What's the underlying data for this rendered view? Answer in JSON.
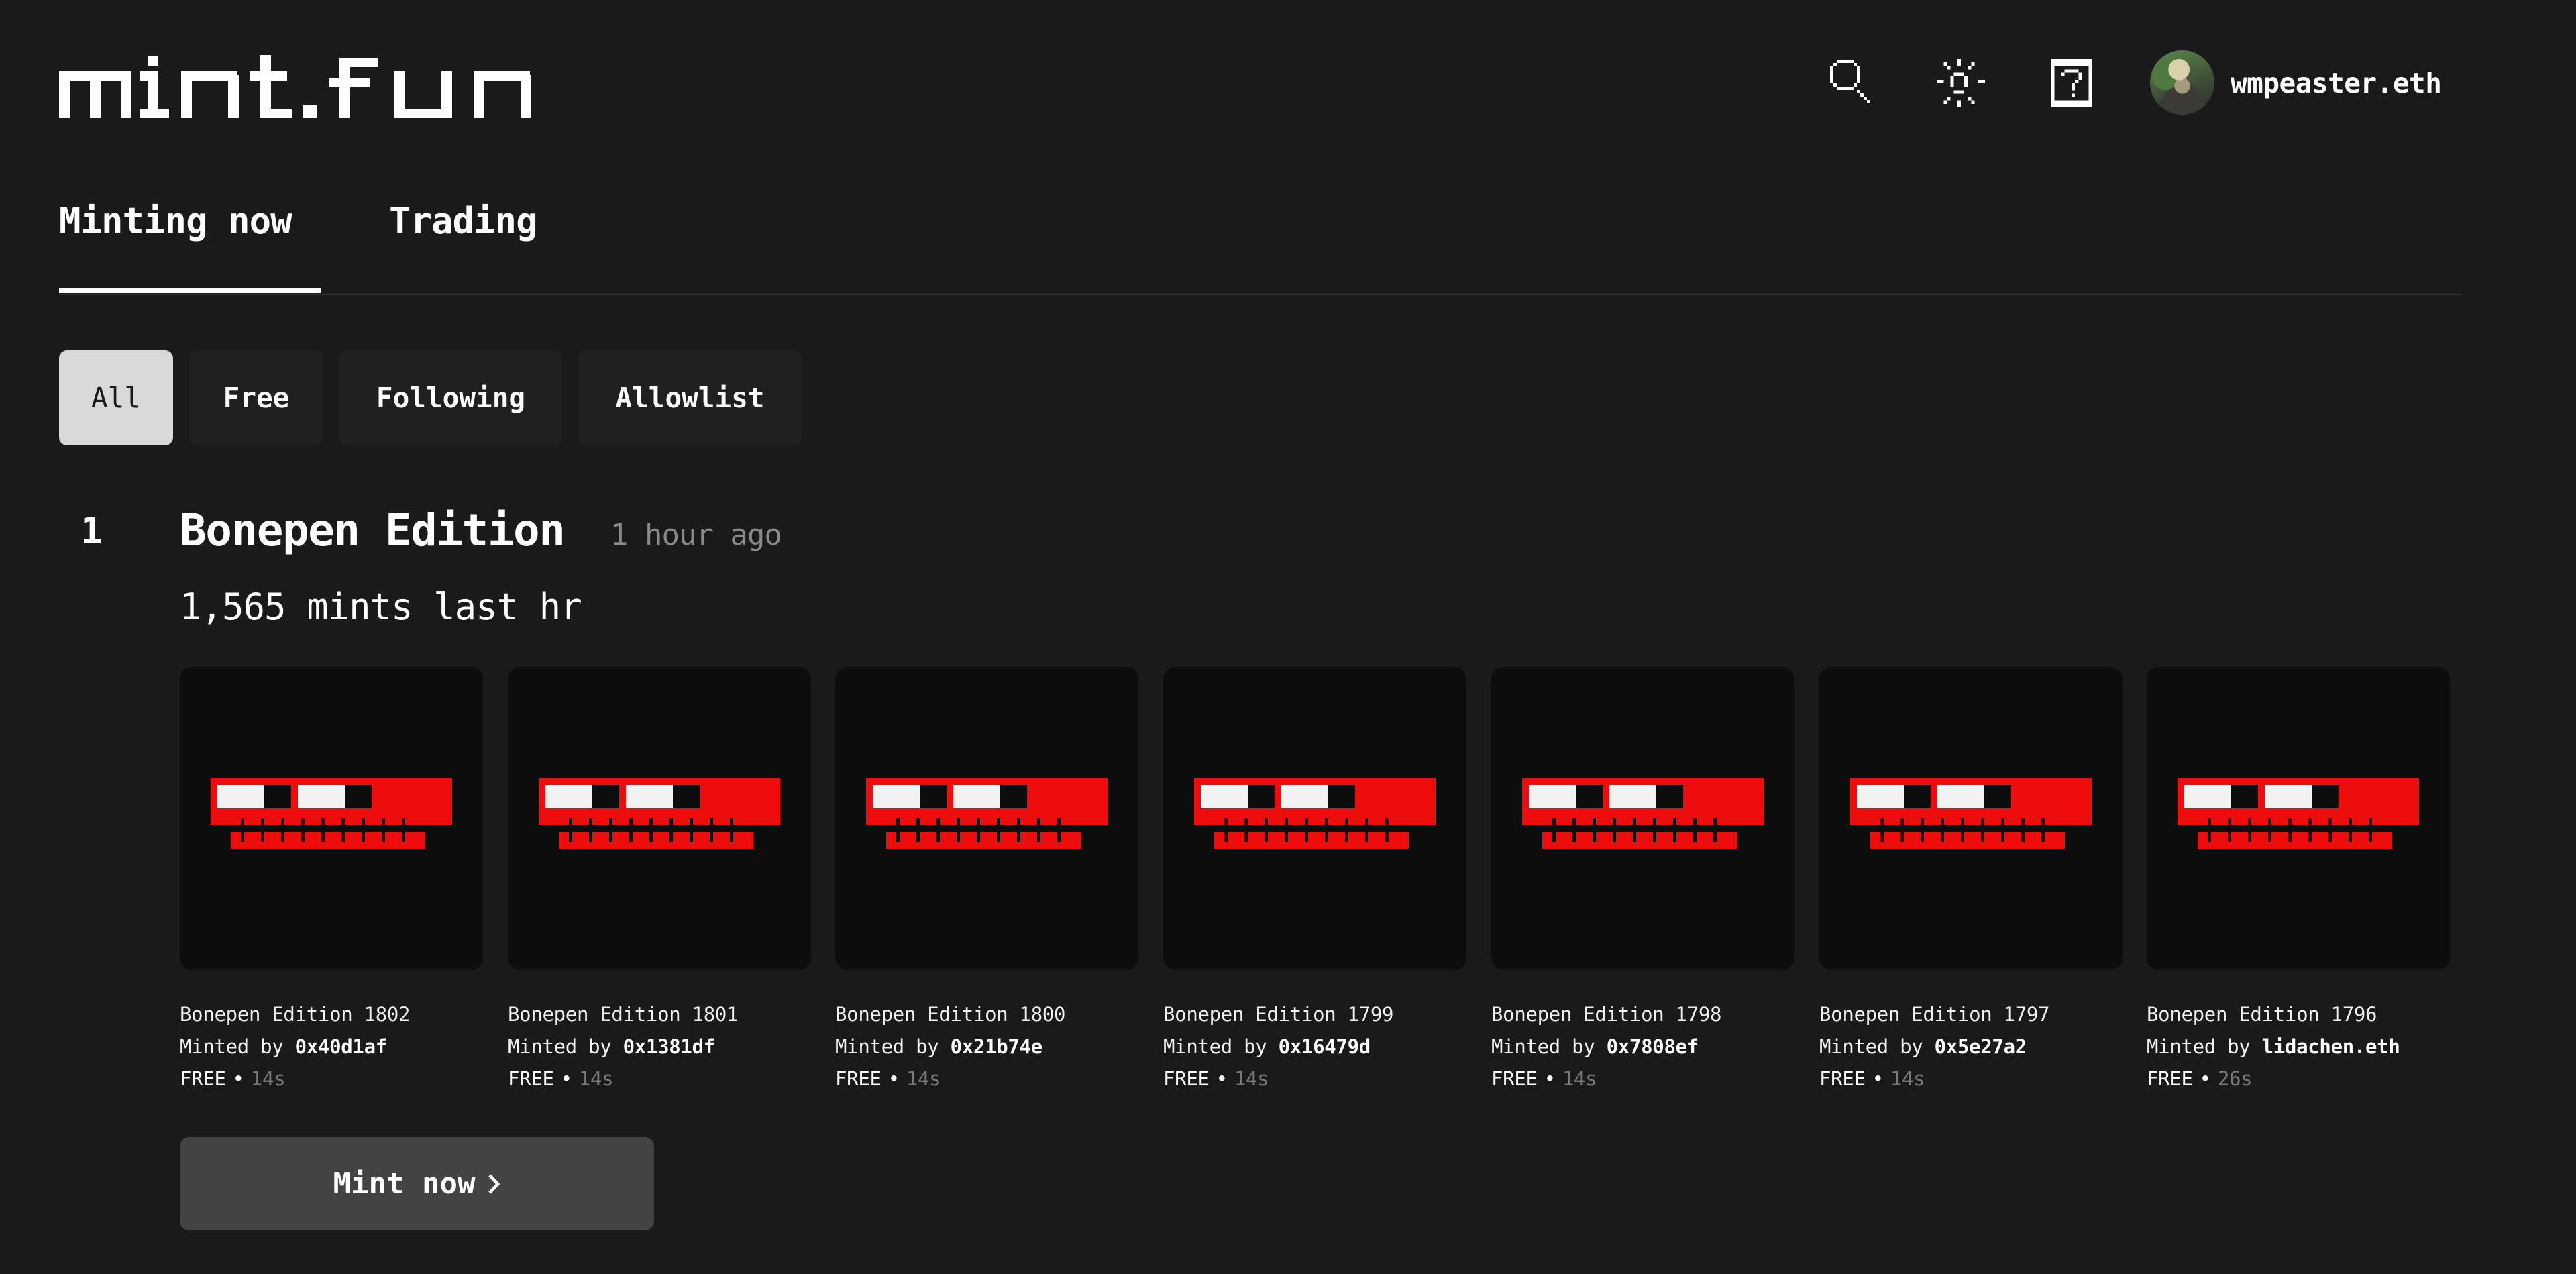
{
  "header": {
    "logo_text": "mint.fun",
    "icons": [
      "search-icon",
      "sun-icon",
      "help-icon"
    ],
    "user": {
      "username": "wmpeaster.eth",
      "avatar": "avatar"
    }
  },
  "tabs": [
    {
      "label": "Minting now",
      "active": true
    },
    {
      "label": "Trading",
      "active": false
    }
  ],
  "filters": [
    {
      "label": "All",
      "active": true
    },
    {
      "label": "Free",
      "active": false
    },
    {
      "label": "Following",
      "active": false
    },
    {
      "label": "Allowlist",
      "active": false
    }
  ],
  "collection": {
    "rank": "1",
    "title": "Bonepen Edition",
    "age": "1 hour ago",
    "mints": "1,565 mints last hr",
    "items": [
      {
        "name": "Bonepen Edition 1802",
        "minted_by_label": "Minted by",
        "minter": "0x40d1af",
        "price": "FREE",
        "separator": "•",
        "time": "14s"
      },
      {
        "name": "Bonepen Edition 1801",
        "minted_by_label": "Minted by",
        "minter": "0x1381df",
        "price": "FREE",
        "separator": "•",
        "time": "14s"
      },
      {
        "name": "Bonepen Edition 1800",
        "minted_by_label": "Minted by",
        "minter": "0x21b74e",
        "price": "FREE",
        "separator": "•",
        "time": "14s"
      },
      {
        "name": "Bonepen Edition 1799",
        "minted_by_label": "Minted by",
        "minter": "0x16479d",
        "price": "FREE",
        "separator": "•",
        "time": "14s"
      },
      {
        "name": "Bonepen Edition 1798",
        "minted_by_label": "Minted by",
        "minter": "0x7808ef",
        "price": "FREE",
        "separator": "•",
        "time": "14s"
      },
      {
        "name": "Bonepen Edition 1797",
        "minted_by_label": "Minted by",
        "minter": "0x5e27a2",
        "price": "FREE",
        "separator": "•",
        "time": "14s"
      },
      {
        "name": "Bonepen Edition 1796",
        "minted_by_label": "Minted by",
        "minter": "lidachen.eth",
        "price": "FREE",
        "separator": "•",
        "time": "26s"
      }
    ],
    "mint_button_label": "Mint now",
    "mint_button_icon": "chevron-right-icon"
  },
  "colors": {
    "background": "#1a1a1a",
    "card_background": "#0d0d0d",
    "artwork_red": "#ee0d0d",
    "artwork_white": "#f2f2f2",
    "filter_active": "#d9d9d9",
    "filter_inactive": "#202020",
    "mint_button": "#434343",
    "muted_text": "#8a8a8a"
  }
}
